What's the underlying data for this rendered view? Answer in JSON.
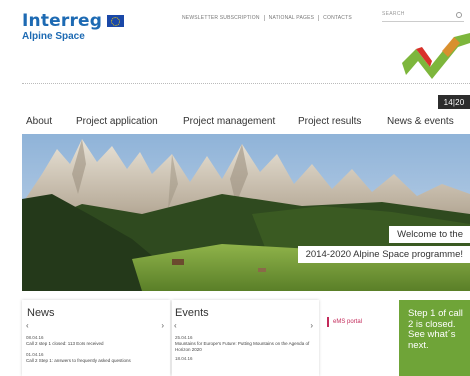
{
  "header": {
    "logo_word": "Interreg",
    "logo_subtitle": "Alpine Space",
    "top_links": [
      "NEWSLETTER SUBSCRIPTION",
      "NATIONAL PAGES",
      "CONTACTS"
    ],
    "search_placeholder": "SEARCH",
    "period_badge": "14|20",
    "zigzag_colors": [
      "#7db63c",
      "#d8302a",
      "#e88a2b"
    ]
  },
  "nav": {
    "items": [
      "About",
      "Project application",
      "Project management",
      "Project results",
      "News & events"
    ]
  },
  "hero": {
    "welcome_line1": "Welcome to the",
    "welcome_line2": "2014-2020 Alpine Space programme!"
  },
  "news": {
    "title": "News",
    "prev": "‹",
    "next": "›",
    "entries": [
      {
        "date": "08.04.16",
        "text": "Call 2 step 1 closed: 113 EoIs received"
      },
      {
        "date": "01.04.16",
        "text": "Call 2 Step 1: answers to frequently asked questions"
      }
    ]
  },
  "events": {
    "title": "Events",
    "prev": "‹",
    "next": "›",
    "entries": [
      {
        "date": "25.04.16",
        "text": "Mountains for Europe's Future: Putting Mountains on the Agenda of Horizon 2020"
      },
      {
        "date": "18.04.16",
        "text": ""
      }
    ]
  },
  "ems": {
    "label": "eMS portal",
    "accent": "#c32a5a"
  },
  "promo": {
    "text": "Step 1 of call 2 is closed. See what´s next.",
    "color": "#6fa438"
  }
}
